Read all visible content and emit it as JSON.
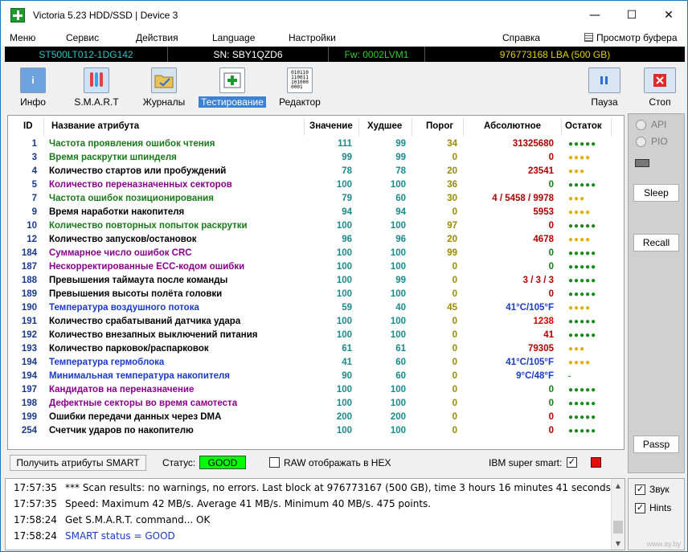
{
  "window": {
    "title": "Victoria 5.23 HDD/SSD | Device 3",
    "minimize": "—",
    "maximize": "☐",
    "close": "✕"
  },
  "menu": {
    "items": [
      "Меню",
      "Сервис",
      "Действия",
      "Language",
      "Настройки",
      "Справка"
    ],
    "buffer_view": "Просмотр буфера"
  },
  "drive": {
    "model": "ST500LT012-1DG142",
    "serial": "SN: SBY1QZD6",
    "firmware": "Fw: 0002LVM1",
    "capacity": "976773168 LBA (500 GB)"
  },
  "toolbar": {
    "info": "Инфо",
    "smart": "S.M.A.R.T",
    "journals": "Журналы",
    "testing": "Тестирование",
    "editor": "Редактор",
    "pause": "Пауза",
    "stop": "Стоп",
    "editor_icon_text": "010110\n110011\n101000\n0001"
  },
  "side_panel": {
    "api": "API",
    "pio": "PIO",
    "sleep": "Sleep",
    "recall": "Recall",
    "passp": "Passp"
  },
  "table": {
    "headers": {
      "id": "ID",
      "name": "Название атрибута",
      "value": "Значение",
      "worst": "Худшее",
      "threshold": "Порог",
      "raw": "Абсолютное",
      "remaining": "Остаток"
    },
    "rows": [
      {
        "id": "1",
        "name": "Частота проявления ошибок чтения",
        "value": "111",
        "worst": "99",
        "thr": "34",
        "raw": "31325680",
        "rem": "●●●●●",
        "nameColor": "#1a7a1a",
        "rawColor": "#b00000",
        "remColor": "#1a8a1a",
        "thrColor": "#9a8a00"
      },
      {
        "id": "3",
        "name": "Время раскрутки шпинделя",
        "value": "99",
        "worst": "99",
        "thr": "0",
        "raw": "0",
        "rem": "●●●●",
        "nameColor": "#1a7a1a",
        "rawColor": "#b00000",
        "remColor": "#e0b000",
        "thrColor": "#9a8a00"
      },
      {
        "id": "4",
        "name": "Количество стартов или пробуждений",
        "value": "78",
        "worst": "78",
        "thr": "20",
        "raw": "23541",
        "rem": "●●●",
        "nameColor": "#000000",
        "rawColor": "#b00000",
        "remColor": "#e0b000",
        "thrColor": "#9a8a00"
      },
      {
        "id": "5",
        "name": "Количество переназначенных секторов",
        "value": "100",
        "worst": "100",
        "thr": "36",
        "raw": "0",
        "rem": "●●●●●",
        "nameColor": "#8a008a",
        "rawColor": "#1a7a1a",
        "remColor": "#1a8a1a",
        "thrColor": "#9a8a00"
      },
      {
        "id": "7",
        "name": "Частота ошибок позиционирования",
        "value": "79",
        "worst": "60",
        "thr": "30",
        "raw": "4 / 5458 / 9978",
        "rem": "●●●",
        "nameColor": "#1a7a1a",
        "rawColor": "#b00000",
        "remColor": "#e0b000",
        "thrColor": "#9a8a00"
      },
      {
        "id": "9",
        "name": "Время наработки накопителя",
        "value": "94",
        "worst": "94",
        "thr": "0",
        "raw": "5953",
        "rem": "●●●●",
        "nameColor": "#000000",
        "rawColor": "#b00000",
        "remColor": "#e0b000",
        "thrColor": "#9a8a00"
      },
      {
        "id": "10",
        "name": "Количество повторных попыток раскрутки",
        "value": "100",
        "worst": "100",
        "thr": "97",
        "raw": "0",
        "rem": "●●●●●",
        "nameColor": "#1a7a1a",
        "rawColor": "#b00000",
        "remColor": "#1a8a1a",
        "thrColor": "#9a8a00"
      },
      {
        "id": "12",
        "name": "Количество запусков/остановок",
        "value": "96",
        "worst": "96",
        "thr": "20",
        "raw": "4678",
        "rem": "●●●●",
        "nameColor": "#000000",
        "rawColor": "#b00000",
        "remColor": "#e0b000",
        "thrColor": "#9a8a00"
      },
      {
        "id": "184",
        "name": "Суммарное число ошибок CRC",
        "value": "100",
        "worst": "100",
        "thr": "99",
        "raw": "0",
        "rem": "●●●●●",
        "nameColor": "#8a008a",
        "rawColor": "#1a7a1a",
        "remColor": "#1a8a1a",
        "thrColor": "#9a8a00"
      },
      {
        "id": "187",
        "name": "Нескорректированные ECC-кодом ошибки",
        "value": "100",
        "worst": "100",
        "thr": "0",
        "raw": "0",
        "rem": "●●●●●",
        "nameColor": "#8a008a",
        "rawColor": "#1a7a1a",
        "remColor": "#1a8a1a",
        "thrColor": "#9a8a00"
      },
      {
        "id": "188",
        "name": "Превышения таймаута после команды",
        "value": "100",
        "worst": "99",
        "thr": "0",
        "raw": "3 / 3 / 3",
        "rem": "●●●●●",
        "nameColor": "#000000",
        "rawColor": "#b00000",
        "remColor": "#1a8a1a",
        "thrColor": "#9a8a00"
      },
      {
        "id": "189",
        "name": "Превышения высоты полёта головки",
        "value": "100",
        "worst": "100",
        "thr": "0",
        "raw": "0",
        "rem": "●●●●●",
        "nameColor": "#000000",
        "rawColor": "#b00000",
        "remColor": "#1a8a1a",
        "thrColor": "#9a8a00"
      },
      {
        "id": "190",
        "name": "Температура воздушного потока",
        "value": "59",
        "worst": "40",
        "thr": "45",
        "raw": "41°C/105°F",
        "rem": "●●●●",
        "nameColor": "#1a3ac8",
        "rawColor": "#1a3ac8",
        "remColor": "#e0b000",
        "thrColor": "#9a8a00"
      },
      {
        "id": "191",
        "name": "Количество срабатываний датчика удара",
        "value": "100",
        "worst": "100",
        "thr": "0",
        "raw": "1238",
        "rem": "●●●●●",
        "nameColor": "#000000",
        "rawColor": "#e00000",
        "remColor": "#1a8a1a",
        "thrColor": "#9a8a00"
      },
      {
        "id": "192",
        "name": "Количество внезапных выключений питания",
        "value": "100",
        "worst": "100",
        "thr": "0",
        "raw": "41",
        "rem": "●●●●●",
        "nameColor": "#000000",
        "rawColor": "#b00000",
        "remColor": "#1a8a1a",
        "thrColor": "#9a8a00"
      },
      {
        "id": "193",
        "name": "Количество парковок/распарковок",
        "value": "61",
        "worst": "61",
        "thr": "0",
        "raw": "79305",
        "rem": "●●●",
        "nameColor": "#000000",
        "rawColor": "#b00000",
        "remColor": "#e0b000",
        "thrColor": "#9a8a00"
      },
      {
        "id": "194",
        "name": "Температура гермоблока",
        "value": "41",
        "worst": "60",
        "thr": "0",
        "raw": "41°C/105°F",
        "rem": "●●●●",
        "nameColor": "#1a3ac8",
        "rawColor": "#1a3ac8",
        "remColor": "#e0b000",
        "thrColor": "#9a8a00"
      },
      {
        "id": "194",
        "name": "Минимальная температура накопителя",
        "value": "90",
        "worst": "60",
        "thr": "0",
        "raw": "9°C/48°F",
        "rem": "-",
        "nameColor": "#1a3ac8",
        "rawColor": "#1a3ac8",
        "remColor": "#1a8a1a",
        "thrColor": "#9a8a00"
      },
      {
        "id": "197",
        "name": "Кандидатов на переназначение",
        "value": "100",
        "worst": "100",
        "thr": "0",
        "raw": "0",
        "rem": "●●●●●",
        "nameColor": "#8a008a",
        "rawColor": "#1a7a1a",
        "remColor": "#1a8a1a",
        "thrColor": "#9a8a00"
      },
      {
        "id": "198",
        "name": "Дефектные секторы во время самотеста",
        "value": "100",
        "worst": "100",
        "thr": "0",
        "raw": "0",
        "rem": "●●●●●",
        "nameColor": "#8a008a",
        "rawColor": "#1a7a1a",
        "remColor": "#1a8a1a",
        "thrColor": "#9a8a00"
      },
      {
        "id": "199",
        "name": "Ошибки передачи данных через DMA",
        "value": "200",
        "worst": "200",
        "thr": "0",
        "raw": "0",
        "rem": "●●●●●",
        "nameColor": "#000000",
        "rawColor": "#b00000",
        "remColor": "#1a8a1a",
        "thrColor": "#9a8a00"
      },
      {
        "id": "254",
        "name": "Счетчик ударов по накопителю",
        "value": "100",
        "worst": "100",
        "thr": "0",
        "raw": "0",
        "rem": "●●●●●",
        "nameColor": "#000000",
        "rawColor": "#b00000",
        "remColor": "#1a8a1a",
        "thrColor": "#9a8a00"
      }
    ]
  },
  "statusbar": {
    "get_smart": "Получить атрибуты SMART",
    "status_label": "Статус:",
    "status_value": "GOOD",
    "raw_hex_label": "RAW отображать в HEX",
    "raw_hex_checked": "",
    "ibm_label": "IBM super smart:",
    "ibm_checked": "✓"
  },
  "log": [
    {
      "time": "17:57:35",
      "text": "*** Scan results: no warnings, no errors. Last block at 976773167 (500 GB), time 3 hours 16 minutes 41 seconds.",
      "color": "#000000"
    },
    {
      "time": "17:57:35",
      "text": "Speed: Maximum 42 MB/s. Average 41 MB/s. Minimum 40 MB/s. 475 points.",
      "color": "#000000"
    },
    {
      "time": "17:58:24",
      "text": "Get S.M.A.R.T. command... OK",
      "color": "#000000"
    },
    {
      "time": "17:58:24",
      "text": "SMART status = GOOD",
      "color": "#1a3ac8"
    }
  ],
  "options": {
    "sound": "Звук",
    "sound_checked": "✓",
    "hints": "Hints",
    "hints_checked": "✓"
  },
  "colors": {
    "value_col": "#1a8a8a",
    "drive_text": "#2ec4c4",
    "fw_text": "#2ecc2e",
    "cap_text": "#e0d000"
  },
  "watermark": "www.ay.by"
}
